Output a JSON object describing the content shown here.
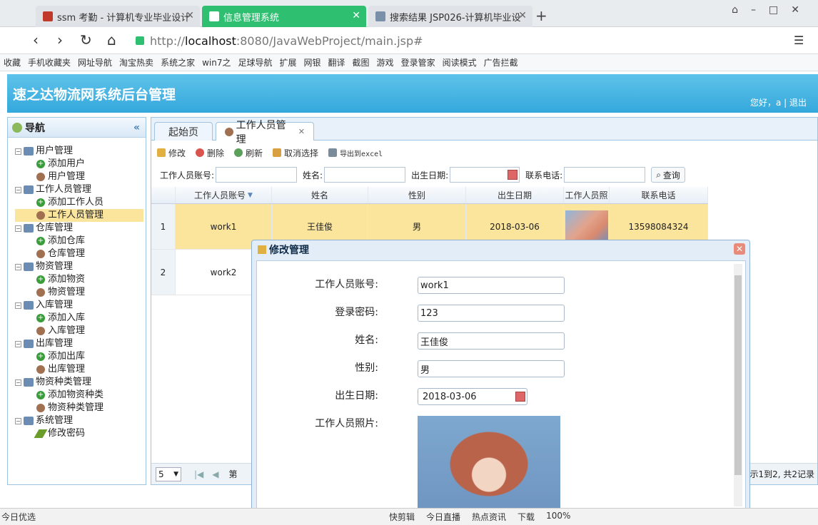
{
  "browser": {
    "tabs": [
      {
        "title": "ssm 考勤 - 计算机专业毕业设计"
      },
      {
        "title": "信息管理系统"
      },
      {
        "title": "搜索结果 JSP026-计算机毕业设"
      }
    ],
    "url_prefix": "http://",
    "url_host": "localhost",
    "url_rest": ":8080/JavaWebProject/main.jsp#",
    "bookmarks": [
      "收藏",
      "手机收藏夹",
      "网址导航",
      "淘宝热卖",
      "系统之家",
      "win7之",
      "足球导航",
      "扩展",
      "网银",
      "翻译",
      "截图",
      "游戏",
      "登录管家",
      "阅读模式",
      "广告拦截"
    ]
  },
  "app": {
    "title": "速之达物流网系统后台管理",
    "greeting": "您好，a | 退出"
  },
  "nav": {
    "header": "导航",
    "tree": [
      {
        "label": "用户管理",
        "children": [
          "添加用户",
          "用户管理"
        ]
      },
      {
        "label": "工作人员管理",
        "children": [
          "添加工作人员",
          "工作人员管理"
        ]
      },
      {
        "label": "仓库管理",
        "children": [
          "添加仓库",
          "仓库管理"
        ]
      },
      {
        "label": "物资管理",
        "children": [
          "添加物资",
          "物资管理"
        ]
      },
      {
        "label": "入库管理",
        "children": [
          "添加入库",
          "入库管理"
        ]
      },
      {
        "label": "出库管理",
        "children": [
          "添加出库",
          "出库管理"
        ]
      },
      {
        "label": "物资种类管理",
        "children": [
          "添加物资种类",
          "物资种类管理"
        ]
      },
      {
        "label": "系统管理",
        "children": [
          "修改密码"
        ]
      }
    ],
    "selected": "工作人员管理"
  },
  "main": {
    "tabs": [
      "起始页",
      "工作人员管理"
    ],
    "toolbar": {
      "edit": "修改",
      "delete": "删除",
      "refresh": "刷新",
      "cancel_select": "取消选择",
      "export": "导出到excel"
    },
    "search": {
      "account_label": "工作人员账号:",
      "name_label": "姓名:",
      "birth_label": "出生日期:",
      "phone_label": "联系电话:",
      "button": "查询"
    },
    "grid": {
      "columns": [
        "工作人员账号",
        "姓名",
        "性别",
        "出生日期",
        "工作人员照",
        "联系电话"
      ],
      "rows": [
        {
          "num": "1",
          "account": "work1",
          "name": "王佳俊",
          "sex": "男",
          "birth": "2018-03-06",
          "phone": "13598084324"
        },
        {
          "num": "2",
          "account": "work2",
          "name": "",
          "sex": "",
          "birth": "",
          "phone": ""
        }
      ]
    },
    "pager": {
      "page_size": "5",
      "page_label": "第",
      "summary": "示1到2, 共2记录"
    }
  },
  "modal": {
    "title": "修改管理",
    "fields": [
      {
        "label": "工作人员账号:",
        "value": "work1"
      },
      {
        "label": "登录密码:",
        "value": "123"
      },
      {
        "label": "姓名:",
        "value": "王佳俊"
      },
      {
        "label": "性别:",
        "value": "男"
      },
      {
        "label": "出生日期:",
        "value": "2018-03-06"
      }
    ],
    "photo_label": "工作人员照片:"
  },
  "statusbar": {
    "left": "今日优选",
    "items": [
      "快剪辑",
      "今日直播",
      "热点资讯",
      "下载",
      "100%"
    ]
  }
}
